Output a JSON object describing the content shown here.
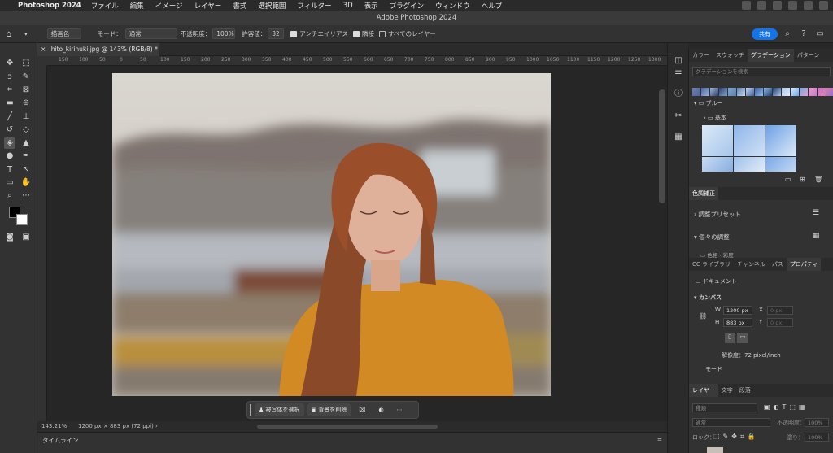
{
  "menubar": {
    "app": "Photoshop 2024",
    "items": [
      "ファイル",
      "編集",
      "イメージ",
      "レイヤー",
      "書式",
      "選択範囲",
      "フィルター",
      "3D",
      "表示",
      "プラグイン",
      "ウィンドウ",
      "ヘルプ"
    ]
  },
  "window": {
    "title": "Adobe Photoshop 2024"
  },
  "options": {
    "mode_source": "描画色",
    "mode_label": "モード：",
    "mode_value": "通常",
    "opacity_label": "不透明度：",
    "opacity_value": "100%",
    "tolerance_label": "許容値：",
    "tolerance_value": "32",
    "antialias": "アンチエイリアス",
    "contiguous": "隣接",
    "all_layers": "すべてのレイヤー",
    "share": "共有"
  },
  "document": {
    "tab": "hito_kirinuki.jpg @ 143% (RGB/8) *",
    "zoom": "143.21%",
    "size": "1200 px × 883 px (72 ppi)"
  },
  "ruler": {
    "ticks": [
      "150",
      "100",
      "50",
      "0",
      "50",
      "100",
      "150",
      "200",
      "250",
      "300",
      "350",
      "400",
      "450",
      "500",
      "550",
      "600",
      "650",
      "700",
      "750",
      "800",
      "850",
      "900",
      "950",
      "1000",
      "1050",
      "1100",
      "1150",
      "1200",
      "1250",
      "1300",
      "1350"
    ]
  },
  "taskbar": {
    "select_subject": "被写体を選択",
    "remove_bg": "背景を削除"
  },
  "timeline": {
    "label": "タイムライン"
  },
  "gradients": {
    "tabs": [
      "カラー",
      "スウォッチ",
      "グラデーション",
      "パターン"
    ],
    "search_placeholder": "グラデーションを検索",
    "group": "ブルー",
    "subgroup": "基本",
    "swatches": [
      "#6f7fa8",
      "#4b63a0",
      "#9fb7d9",
      "#2e3f6a",
      "#7fa7cf",
      "#5f7fae",
      "#c7d8ee",
      "#3d5f9d",
      "#8fbce8",
      "#1f3a6e",
      "#b0c8e6",
      "#dcecfa",
      "#6aa9e6",
      "#e6a1c8",
      "#c779c9",
      "#e07ab0",
      "#8a6fd0",
      "#e0a0e0"
    ]
  },
  "adjustments": {
    "title": "色調補正",
    "presets": "調整プリセット",
    "individual": "個々の調整",
    "cut_row": "色相・彩度"
  },
  "properties": {
    "tabs": [
      "CC ライブラリ",
      "チャンネル",
      "パス",
      "プロパティ"
    ],
    "doc": "ドキュメント",
    "canvas": "カンバス",
    "w_label": "W",
    "w_value": "1200 px",
    "h_label": "H",
    "h_value": "883 px",
    "x_label": "X",
    "x_value": "0 px",
    "y_label": "Y",
    "y_value": "0 px",
    "resolution": "解像度：72 pixel/inch",
    "mode": "モード"
  },
  "layers": {
    "tabs": [
      "レイヤー",
      "文字",
      "段落"
    ],
    "kind_placeholder": "種類",
    "blend": "通常",
    "opacity_label": "不透明度：",
    "opacity_value": "100%",
    "lock_label": "ロック：",
    "fill_label": "塗り：",
    "fill_value": "100%"
  }
}
